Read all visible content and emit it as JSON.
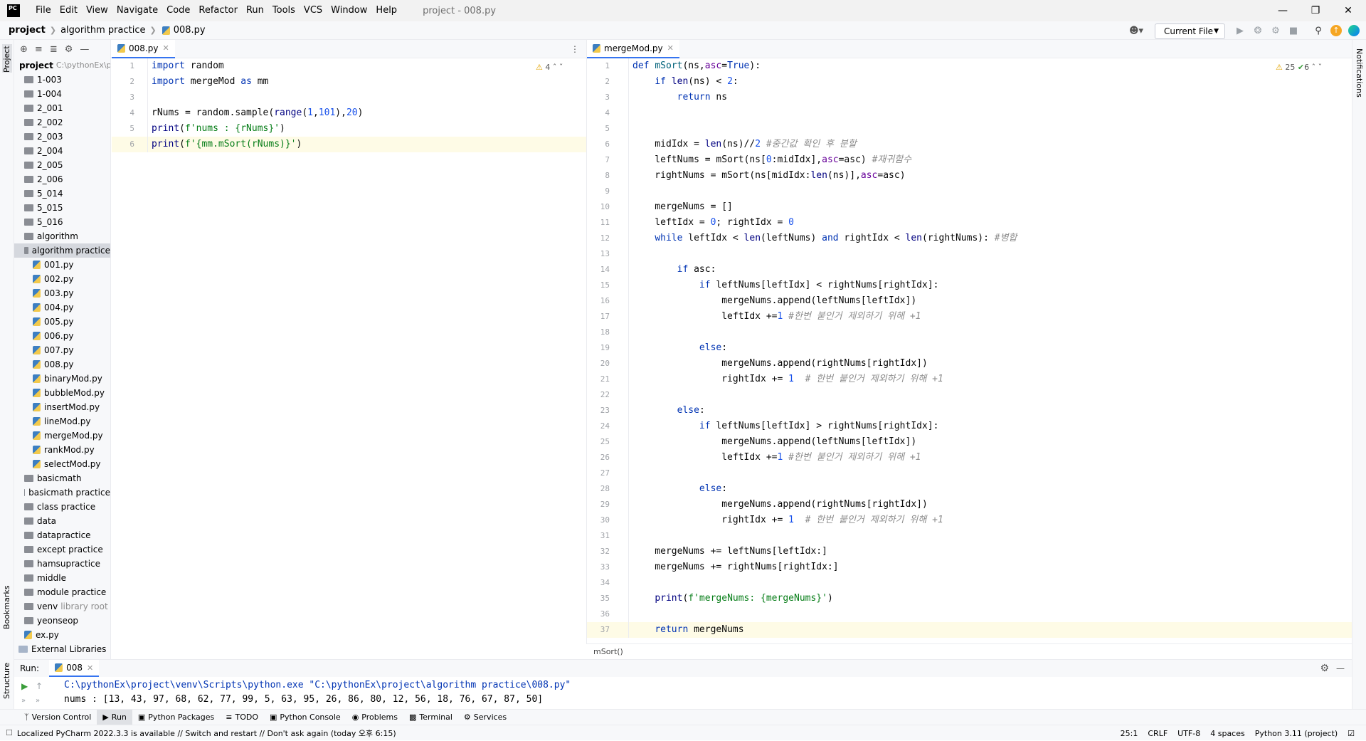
{
  "window": {
    "logo": "PC",
    "title": "project - 008.py",
    "menu": [
      "File",
      "Edit",
      "View",
      "Navigate",
      "Code",
      "Refactor",
      "Run",
      "Tools",
      "VCS",
      "Window",
      "Help"
    ]
  },
  "nav": {
    "crumbs": [
      "project",
      "algorithm practice",
      "008.py"
    ],
    "run_config": "Current File"
  },
  "sidebar": {
    "left_labels": [
      "Project",
      "Bookmarks",
      "Structure"
    ],
    "right_labels": [
      "Notifications"
    ]
  },
  "project": {
    "root_label": "project",
    "root_path": "C:\\pythonEx\\project",
    "items": [
      {
        "label": "1-003",
        "type": "folder",
        "indent": 1
      },
      {
        "label": "1-004",
        "type": "folder",
        "indent": 1
      },
      {
        "label": "2_001",
        "type": "folder",
        "indent": 1
      },
      {
        "label": "2_002",
        "type": "folder",
        "indent": 1
      },
      {
        "label": "2_003",
        "type": "folder",
        "indent": 1
      },
      {
        "label": "2_004",
        "type": "folder",
        "indent": 1
      },
      {
        "label": "2_005",
        "type": "folder",
        "indent": 1
      },
      {
        "label": "2_006",
        "type": "folder",
        "indent": 1
      },
      {
        "label": "5_014",
        "type": "folder",
        "indent": 1
      },
      {
        "label": "5_015",
        "type": "folder",
        "indent": 1
      },
      {
        "label": "5_016",
        "type": "folder",
        "indent": 1
      },
      {
        "label": "algorithm",
        "type": "folder",
        "indent": 1
      },
      {
        "label": "algorithm practice",
        "type": "folder",
        "indent": 1,
        "selected": true
      },
      {
        "label": "001.py",
        "type": "py",
        "indent": 2
      },
      {
        "label": "002.py",
        "type": "py",
        "indent": 2
      },
      {
        "label": "003.py",
        "type": "py",
        "indent": 2
      },
      {
        "label": "004.py",
        "type": "py",
        "indent": 2
      },
      {
        "label": "005.py",
        "type": "py",
        "indent": 2
      },
      {
        "label": "006.py",
        "type": "py",
        "indent": 2
      },
      {
        "label": "007.py",
        "type": "py",
        "indent": 2
      },
      {
        "label": "008.py",
        "type": "py",
        "indent": 2
      },
      {
        "label": "binaryMod.py",
        "type": "py",
        "indent": 2
      },
      {
        "label": "bubbleMod.py",
        "type": "py",
        "indent": 2
      },
      {
        "label": "insertMod.py",
        "type": "py",
        "indent": 2
      },
      {
        "label": "lineMod.py",
        "type": "py",
        "indent": 2
      },
      {
        "label": "mergeMod.py",
        "type": "py",
        "indent": 2
      },
      {
        "label": "rankMod.py",
        "type": "py",
        "indent": 2
      },
      {
        "label": "selectMod.py",
        "type": "py",
        "indent": 2
      },
      {
        "label": "basicmath",
        "type": "folder",
        "indent": 1
      },
      {
        "label": "basicmath practice",
        "type": "folder",
        "indent": 1
      },
      {
        "label": "class practice",
        "type": "folder",
        "indent": 1
      },
      {
        "label": "data",
        "type": "folder",
        "indent": 1
      },
      {
        "label": "datapractice",
        "type": "folder",
        "indent": 1
      },
      {
        "label": "except practice",
        "type": "folder",
        "indent": 1
      },
      {
        "label": "hamsupractice",
        "type": "folder",
        "indent": 1
      },
      {
        "label": "middle",
        "type": "folder",
        "indent": 1
      },
      {
        "label": "module practice",
        "type": "folder",
        "indent": 1
      },
      {
        "label": "venv",
        "type": "folder",
        "indent": 1,
        "note": "library root"
      },
      {
        "label": "yeonseop",
        "type": "folder",
        "indent": 1
      },
      {
        "label": "ex.py",
        "type": "py",
        "indent": 1
      },
      {
        "label": "External Libraries",
        "type": "lib",
        "indent": 0
      }
    ]
  },
  "editor_left": {
    "tab": "008.py",
    "inspection": "4",
    "lines": [
      "import random",
      "import mergeMod as mm",
      "",
      "rNums = random.sample(range(1,101),20)",
      "print(f'nums : {rNums}')",
      "print(f'{mm.mSort(rNums)}')"
    ]
  },
  "editor_right": {
    "tab": "mergeMod.py",
    "warnings": "25",
    "checks": "6",
    "breadcrumb": "mSort()",
    "lines": [
      "def mSort(ns,asc=True):",
      "    if len(ns) < 2:",
      "        return ns",
      "",
      "",
      "    midIdx = len(ns)//2 #중간값 확인 후 분할",
      "    leftNums = mSort(ns[0:midIdx],asc=asc) #재귀함수",
      "    rightNums = mSort(ns[midIdx:len(ns)],asc=asc)",
      "",
      "    mergeNums = []",
      "    leftIdx = 0; rightIdx = 0",
      "    while leftIdx < len(leftNums) and rightIdx < len(rightNums): #병합",
      "",
      "        if asc:",
      "            if leftNums[leftIdx] < rightNums[rightIdx]:",
      "                mergeNums.append(leftNums[leftIdx])",
      "                leftIdx +=1 #한번 붙인거 제외하기 위해 +1",
      "",
      "            else:",
      "                mergeNums.append(rightNums[rightIdx])",
      "                rightIdx += 1  # 한번 붙인거 제외하기 위해 +1",
      "",
      "        else:",
      "            if leftNums[leftIdx] > rightNums[rightIdx]:",
      "                mergeNums.append(leftNums[leftIdx])",
      "                leftIdx +=1 #한번 붙인거 제외하기 위해 +1",
      "",
      "            else:",
      "                mergeNums.append(rightNums[rightIdx])",
      "                rightIdx += 1  # 한번 붙인거 제외하기 위해 +1",
      "",
      "    mergeNums += leftNums[leftIdx:]",
      "    mergeNums += rightNums[rightIdx:]",
      "",
      "    print(f'mergeNums: {mergeNums}')",
      "",
      "    return mergeNums"
    ]
  },
  "run": {
    "label": "Run:",
    "tab": "008",
    "command": "C:\\pythonEx\\project\\venv\\Scripts\\python.exe \"C:\\pythonEx\\project\\algorithm practice\\008.py\"",
    "output": "nums : [13, 43, 97, 68, 62, 77, 99, 5, 63, 95, 26, 86, 80, 12, 56, 18, 76, 67, 87, 50]"
  },
  "bottom_tabs": [
    "Version Control",
    "Run",
    "Python Packages",
    "TODO",
    "Python Console",
    "Problems",
    "Terminal",
    "Services"
  ],
  "status": {
    "message": "Localized PyCharm 2022.3.3 is available // Switch and restart // Don't ask again (today 오후 6:15)",
    "position": "25:1",
    "line_sep": "CRLF",
    "encoding": "UTF-8",
    "indent": "4 spaces",
    "interpreter": "Python 3.11 (project)"
  }
}
